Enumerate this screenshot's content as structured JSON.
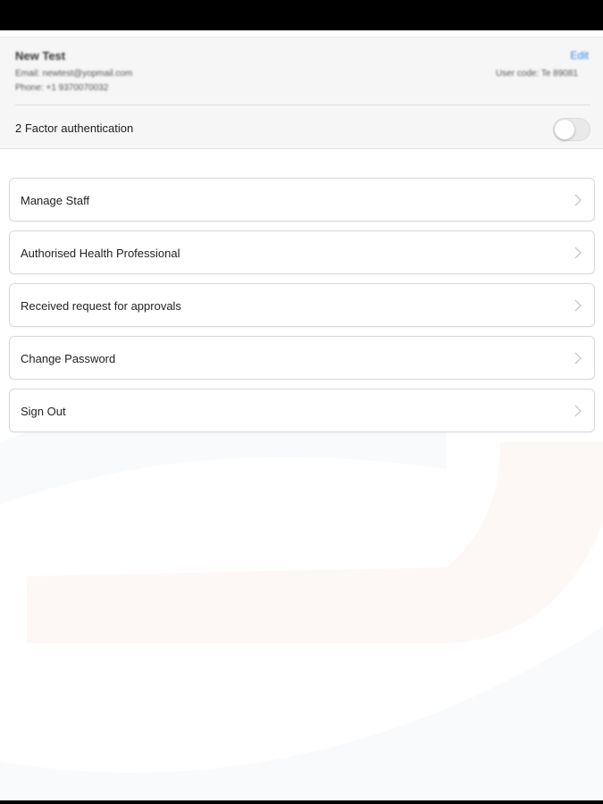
{
  "profile": {
    "name": "New Test",
    "email": "Email: newtest@yopmail.com",
    "phone": "Phone: +1 9370070032",
    "user_code": "User code: Te 89081",
    "edit_label": "Edit"
  },
  "security": {
    "twofa_label": "2 Factor authentication",
    "twofa_enabled": false
  },
  "menu": [
    {
      "label": "Manage Staff",
      "icon": "chevron-right-icon"
    },
    {
      "label": "Authorised Health Professional",
      "icon": "chevron-right-icon"
    },
    {
      "label": "Received request for approvals",
      "icon": "chevron-right-icon"
    },
    {
      "label": "Change Password",
      "icon": "chevron-right-icon"
    },
    {
      "label": "Sign Out",
      "icon": "chevron-right-icon"
    }
  ],
  "colors": {
    "accent": "#2f87e8",
    "card_background": "#f6f6f7",
    "border": "#d9d9db"
  }
}
